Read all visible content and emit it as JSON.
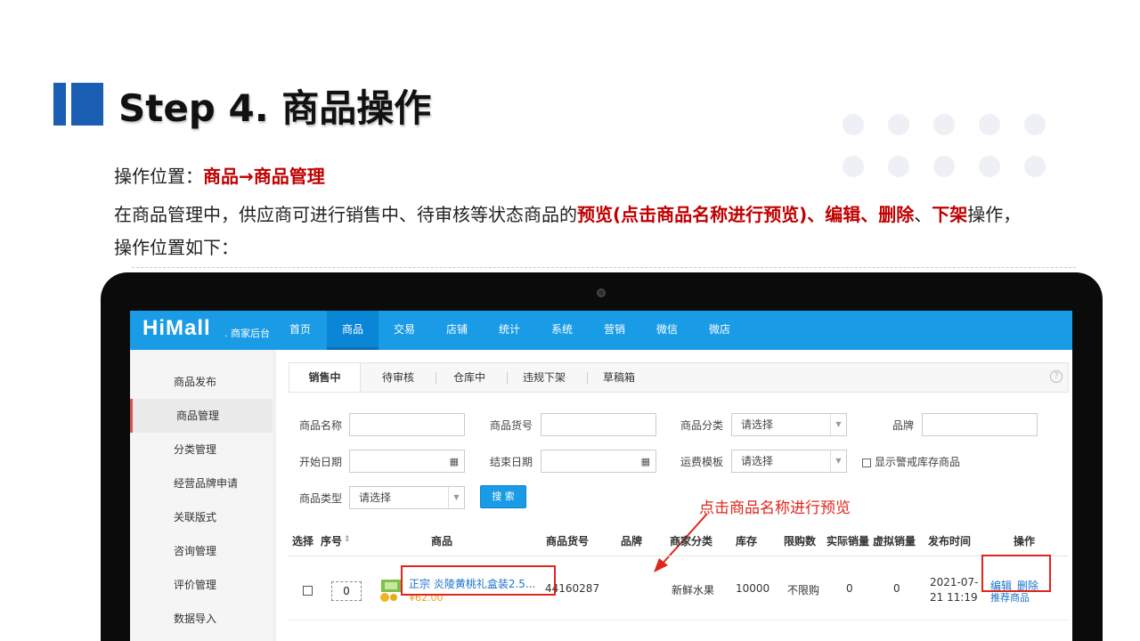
{
  "slide": {
    "title": "Step 4. 商品操作",
    "line1_prefix": "操作位置：",
    "line1_highlight": "商品→商品管理",
    "line2_a": "在商品管理中，供应商可进行销售中、待审核等状态商品的",
    "line2_b": "预览(点击商品名称进行预览)、编辑、删除",
    "line2_c": "、",
    "line2_d": "下架",
    "line2_e": "操作，",
    "line3": "操作位置如下："
  },
  "app": {
    "logo": "HiMall",
    "logo_sub": ". 商家后台",
    "nav": [
      "首页",
      "商品",
      "交易",
      "店铺",
      "统计",
      "系统",
      "营销",
      "微信",
      "微店"
    ],
    "nav_active": "商品",
    "sidebar": [
      "商品发布",
      "商品管理",
      "分类管理",
      "经营品牌申请",
      "关联版式",
      "咨询管理",
      "评价管理",
      "数据导入"
    ],
    "sidebar_active": "商品管理",
    "tabs": [
      "销售中",
      "待审核",
      "仓库中",
      "违规下架",
      "草稿箱"
    ],
    "help_icon": "?",
    "filters": {
      "name_label": "商品名称",
      "sku_label": "商品货号",
      "category_label": "商品分类",
      "category_value": "请选择",
      "brand_label": "品牌",
      "start_label": "开始日期",
      "end_label": "结束日期",
      "freight_label": "运费模板",
      "freight_value": "请选择",
      "warning_label": "显示警戒库存商品",
      "type_label": "商品类型",
      "type_value": "请选择",
      "search_button": "搜 索"
    },
    "annotation": "点击商品名称进行预览",
    "table": {
      "headers": [
        "选择",
        "序号",
        "商品",
        "商品货号",
        "品牌",
        "商家分类",
        "库存",
        "限购数",
        "实际销量",
        "虚拟销量",
        "发布时间",
        "操作"
      ],
      "row": {
        "seq": "0",
        "name": "正宗 炎陵黄桃礼盒装2.5...",
        "price": "¥62.00",
        "sku": "44160287",
        "brand": "",
        "category": "新鲜水果",
        "stock": "10000",
        "limit": "不限购",
        "real_sales": "0",
        "virtual_sales": "0",
        "date_line1": "2021-07-",
        "date_line2": "21 11:19",
        "action_edit": "编辑",
        "action_delete": "删除",
        "action_recommend": "推荐商品"
      }
    }
  },
  "colors": {
    "accent_blue": "#1a9be6",
    "title_block": "#1a5fb4",
    "highlight_red": "#c00000",
    "annotation_red": "#e0251b"
  }
}
